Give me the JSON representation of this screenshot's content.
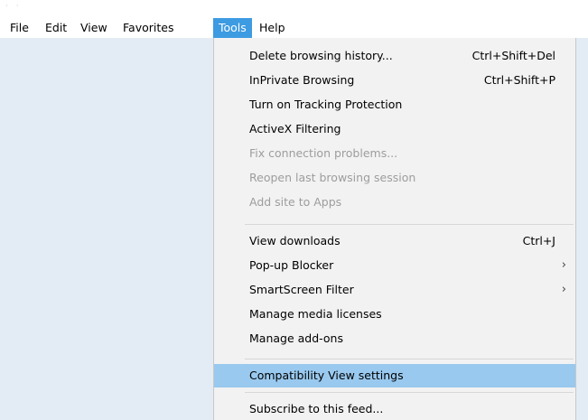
{
  "menubar": {
    "items": [
      {
        "label": "File"
      },
      {
        "label": "Edit"
      },
      {
        "label": "View"
      },
      {
        "label": "Favorites"
      },
      {
        "label": "Tools"
      },
      {
        "label": "Help"
      }
    ],
    "active_index": 4
  },
  "tools_menu": {
    "groups": [
      [
        {
          "label": "Delete browsing history...",
          "shortcut": "Ctrl+Shift+Del",
          "enabled": true
        },
        {
          "label": "InPrivate Browsing",
          "shortcut": "Ctrl+Shift+P",
          "enabled": true
        },
        {
          "label": "Turn on Tracking Protection",
          "shortcut": "",
          "enabled": true
        },
        {
          "label": "ActiveX Filtering",
          "shortcut": "",
          "enabled": true
        },
        {
          "label": "Fix connection problems...",
          "shortcut": "",
          "enabled": false
        },
        {
          "label": "Reopen last browsing session",
          "shortcut": "",
          "enabled": false
        },
        {
          "label": "Add site to Apps",
          "shortcut": "",
          "enabled": false
        }
      ],
      [
        {
          "label": "View downloads",
          "shortcut": "Ctrl+J",
          "enabled": true
        },
        {
          "label": "Pop-up Blocker",
          "shortcut": "",
          "submenu": true,
          "enabled": true
        },
        {
          "label": "SmartScreen Filter",
          "shortcut": "",
          "submenu": true,
          "enabled": true
        },
        {
          "label": "Manage media licenses",
          "shortcut": "",
          "enabled": true
        },
        {
          "label": "Manage add-ons",
          "shortcut": "",
          "enabled": true
        }
      ],
      [
        {
          "label": "Compatibility View settings",
          "shortcut": "",
          "enabled": true,
          "highlighted": true
        }
      ],
      [
        {
          "label": "Subscribe to this feed...",
          "shortcut": "",
          "enabled": true
        }
      ]
    ]
  },
  "colors": {
    "menubar_active": "#3d9be2",
    "highlight": "#99c9ef",
    "menu_bg": "#f2f2f2",
    "content_bg": "#e3ebf4",
    "disabled_text": "#9d9d9d"
  }
}
